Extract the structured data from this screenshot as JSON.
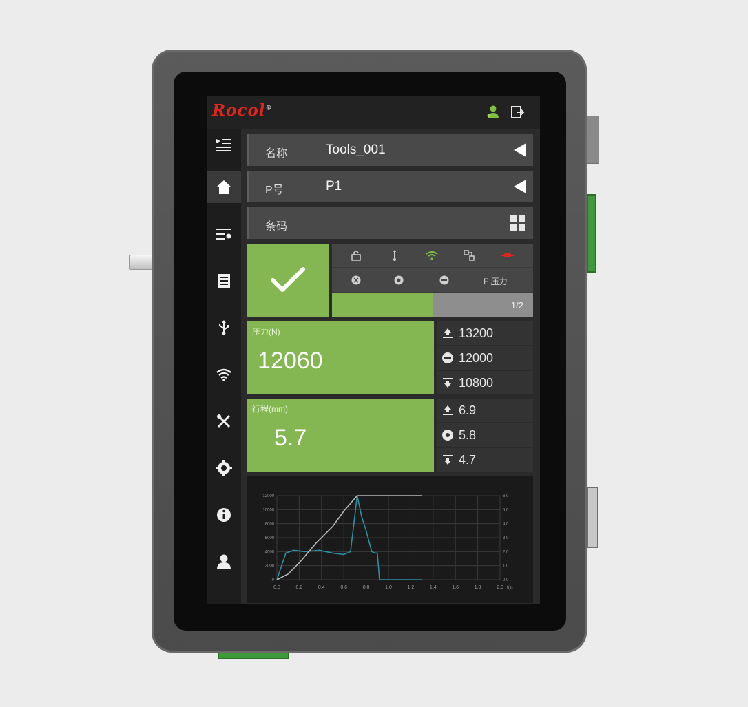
{
  "device": {
    "logo": "Rocol",
    "logo_mark": "®"
  },
  "topbar": {
    "icons": [
      "user-status-icon",
      "logout-icon"
    ]
  },
  "sidebar": {
    "items": [
      {
        "name": "menu-toggle",
        "icon": "menu-collapse-icon"
      },
      {
        "name": "home",
        "icon": "home-icon",
        "active": true
      },
      {
        "name": "list-settings",
        "icon": "list-settings-icon"
      },
      {
        "name": "records",
        "icon": "document-icon"
      },
      {
        "name": "usb",
        "icon": "usb-icon"
      },
      {
        "name": "wifi",
        "icon": "wifi-icon"
      },
      {
        "name": "tools",
        "icon": "tools-icon"
      },
      {
        "name": "settings",
        "icon": "gear-icon"
      },
      {
        "name": "info",
        "icon": "info-icon"
      },
      {
        "name": "user",
        "icon": "user-icon"
      }
    ]
  },
  "rows": {
    "name": {
      "label": "名称",
      "value": "Tools_001"
    },
    "program": {
      "label": "P号",
      "value": "P1"
    },
    "barcode": {
      "label": "条码",
      "value": ""
    }
  },
  "status": {
    "result_icon": "check-icon",
    "row1_icons": [
      "lock-icon",
      "usb-status-icon",
      "wifi-status-icon",
      "link-icon",
      "plug-icon"
    ],
    "row2_icons": [
      "sensor-icon",
      "circle-icon",
      "minus-circle-icon"
    ],
    "row2_text": "F 压力",
    "progress": {
      "fraction": 0.5,
      "text": "1/2"
    },
    "colors": {
      "ok": "#84b752",
      "wifi": "#7fc043",
      "plug": "#e0261c"
    }
  },
  "force": {
    "caption": "压力(N)",
    "value": "12060",
    "upper": "13200",
    "target": "12000",
    "lower": "10800"
  },
  "stroke": {
    "caption": "行程(mm)",
    "value": "5.7",
    "upper": "6.9",
    "target": "5.8",
    "lower": "4.7"
  },
  "chart_data": {
    "type": "line",
    "y_left_ticks": [
      "12000",
      "10000",
      "8000",
      "6000",
      "4000",
      "2000",
      "0"
    ],
    "y_right_ticks": [
      "6.0",
      "5.0",
      "4.0",
      "3.0",
      "2.0",
      "1.0",
      "0.0"
    ],
    "x_ticks": [
      "0.0",
      "0.2",
      "0.4",
      "0.6",
      "0.8",
      "1.0",
      "1.2",
      "1.4",
      "1.6",
      "1.8",
      "2.0"
    ],
    "x_unit": "t(s)",
    "ylim_left": [
      0,
      12000
    ],
    "ylim_right": [
      0,
      6
    ],
    "xlim": [
      0,
      2
    ],
    "grid": true,
    "series": [
      {
        "axis": "left",
        "color": "#2e8fa3",
        "x": [
          0.0,
          0.08,
          0.15,
          0.25,
          0.38,
          0.5,
          0.6,
          0.66,
          0.72,
          0.76,
          0.8,
          0.85,
          0.88,
          0.9,
          0.92,
          0.95,
          1.0,
          1.05,
          1.2,
          1.3
        ],
        "y": [
          0,
          3800,
          4200,
          4000,
          4200,
          3800,
          3600,
          4000,
          12000,
          9000,
          7000,
          4000,
          3800,
          3800,
          0,
          0,
          0,
          0,
          0,
          0
        ]
      },
      {
        "axis": "right",
        "color": "#b8b8b8",
        "x": [
          0.0,
          0.1,
          0.2,
          0.35,
          0.5,
          0.6,
          0.72,
          0.8,
          0.9,
          1.0,
          1.1,
          1.3
        ],
        "y": [
          0.0,
          0.4,
          1.2,
          2.6,
          3.8,
          4.9,
          6.0,
          6.0,
          6.0,
          6.0,
          6.0,
          6.0
        ]
      }
    ]
  }
}
